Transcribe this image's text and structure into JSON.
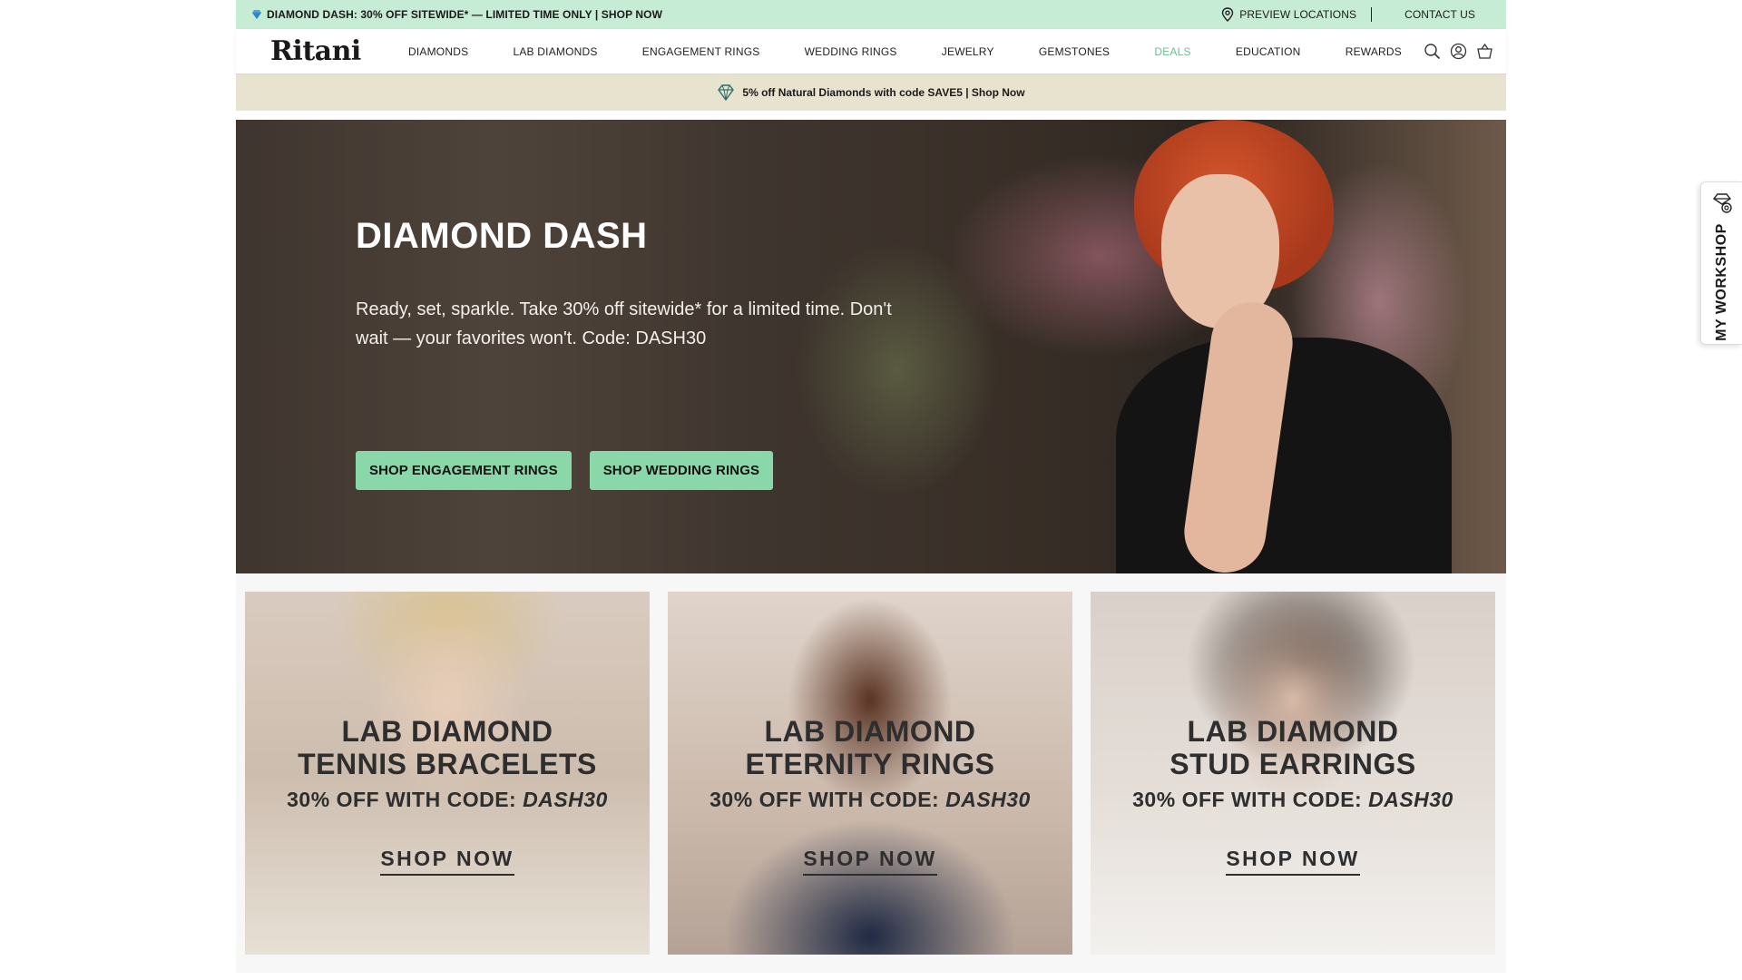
{
  "topbar": {
    "promo": "DIAMOND DASH: 30% OFF SITEWIDE* — LIMITED TIME ONLY | SHOP NOW",
    "preview_locations": "PREVIEW LOCATIONS",
    "contact_us": "CONTACT US"
  },
  "nav": {
    "logo": "Ritani",
    "items": [
      "DIAMONDS",
      "LAB DIAMONDS",
      "ENGAGEMENT RINGS",
      "WEDDING RINGS",
      "JEWELRY",
      "GEMSTONES",
      "DEALS",
      "EDUCATION",
      "REWARDS"
    ],
    "accent_color": "#6fbf95"
  },
  "subpromo": {
    "text": "5% off Natural Diamonds with code SAVE5 | Shop Now"
  },
  "hero": {
    "title": "DIAMOND DASH",
    "subtitle": "Ready, set, sparkle. Take 30% off sitewide* for a limited time. Don't wait — your favorites won't. Code: DASH30",
    "buttons": [
      "SHOP ENGAGEMENT RINGS",
      "SHOP WEDDING RINGS"
    ],
    "button_color": "#8ad8a9"
  },
  "tiles": [
    {
      "line1": "LAB DIAMOND",
      "line2": "TENNIS BRACELETS",
      "code_prefix": "30% OFF WITH CODE: ",
      "code": "DASH30",
      "cta": "SHOP NOW"
    },
    {
      "line1": "LAB DIAMOND",
      "line2": "ETERNITY RINGS",
      "code_prefix": "30% OFF WITH CODE: ",
      "code": "DASH30",
      "cta": "SHOP NOW"
    },
    {
      "line1": "LAB DIAMOND",
      "line2": "STUD EARRINGS",
      "code_prefix": "30% OFF WITH CODE: ",
      "code": "DASH30",
      "cta": "SHOP NOW"
    }
  ],
  "side_tab": {
    "label": "MY WORKSHOP"
  },
  "colors": {
    "topbar_bg": "#c7ecd5",
    "subpromo_bg": "#e8e3cf"
  }
}
